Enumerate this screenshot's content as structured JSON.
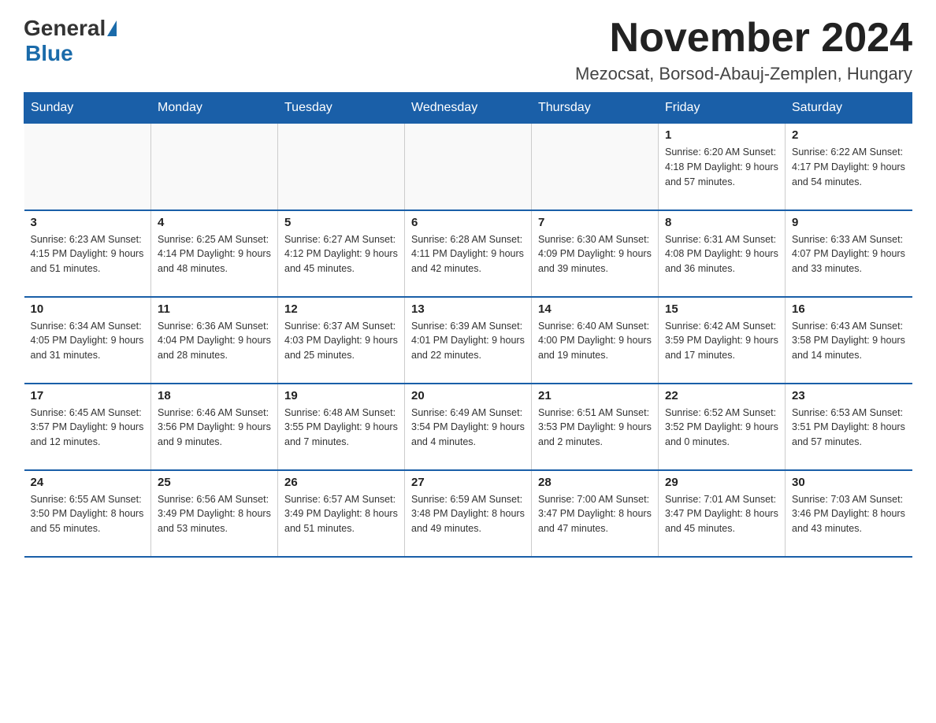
{
  "header": {
    "logo_general": "General",
    "logo_blue": "Blue",
    "month_year": "November 2024",
    "location": "Mezocsat, Borsod-Abauj-Zemplen, Hungary"
  },
  "weekdays": [
    "Sunday",
    "Monday",
    "Tuesday",
    "Wednesday",
    "Thursday",
    "Friday",
    "Saturday"
  ],
  "weeks": [
    [
      {
        "day": "",
        "info": ""
      },
      {
        "day": "",
        "info": ""
      },
      {
        "day": "",
        "info": ""
      },
      {
        "day": "",
        "info": ""
      },
      {
        "day": "",
        "info": ""
      },
      {
        "day": "1",
        "info": "Sunrise: 6:20 AM\nSunset: 4:18 PM\nDaylight: 9 hours and 57 minutes."
      },
      {
        "day": "2",
        "info": "Sunrise: 6:22 AM\nSunset: 4:17 PM\nDaylight: 9 hours and 54 minutes."
      }
    ],
    [
      {
        "day": "3",
        "info": "Sunrise: 6:23 AM\nSunset: 4:15 PM\nDaylight: 9 hours and 51 minutes."
      },
      {
        "day": "4",
        "info": "Sunrise: 6:25 AM\nSunset: 4:14 PM\nDaylight: 9 hours and 48 minutes."
      },
      {
        "day": "5",
        "info": "Sunrise: 6:27 AM\nSunset: 4:12 PM\nDaylight: 9 hours and 45 minutes."
      },
      {
        "day": "6",
        "info": "Sunrise: 6:28 AM\nSunset: 4:11 PM\nDaylight: 9 hours and 42 minutes."
      },
      {
        "day": "7",
        "info": "Sunrise: 6:30 AM\nSunset: 4:09 PM\nDaylight: 9 hours and 39 minutes."
      },
      {
        "day": "8",
        "info": "Sunrise: 6:31 AM\nSunset: 4:08 PM\nDaylight: 9 hours and 36 minutes."
      },
      {
        "day": "9",
        "info": "Sunrise: 6:33 AM\nSunset: 4:07 PM\nDaylight: 9 hours and 33 minutes."
      }
    ],
    [
      {
        "day": "10",
        "info": "Sunrise: 6:34 AM\nSunset: 4:05 PM\nDaylight: 9 hours and 31 minutes."
      },
      {
        "day": "11",
        "info": "Sunrise: 6:36 AM\nSunset: 4:04 PM\nDaylight: 9 hours and 28 minutes."
      },
      {
        "day": "12",
        "info": "Sunrise: 6:37 AM\nSunset: 4:03 PM\nDaylight: 9 hours and 25 minutes."
      },
      {
        "day": "13",
        "info": "Sunrise: 6:39 AM\nSunset: 4:01 PM\nDaylight: 9 hours and 22 minutes."
      },
      {
        "day": "14",
        "info": "Sunrise: 6:40 AM\nSunset: 4:00 PM\nDaylight: 9 hours and 19 minutes."
      },
      {
        "day": "15",
        "info": "Sunrise: 6:42 AM\nSunset: 3:59 PM\nDaylight: 9 hours and 17 minutes."
      },
      {
        "day": "16",
        "info": "Sunrise: 6:43 AM\nSunset: 3:58 PM\nDaylight: 9 hours and 14 minutes."
      }
    ],
    [
      {
        "day": "17",
        "info": "Sunrise: 6:45 AM\nSunset: 3:57 PM\nDaylight: 9 hours and 12 minutes."
      },
      {
        "day": "18",
        "info": "Sunrise: 6:46 AM\nSunset: 3:56 PM\nDaylight: 9 hours and 9 minutes."
      },
      {
        "day": "19",
        "info": "Sunrise: 6:48 AM\nSunset: 3:55 PM\nDaylight: 9 hours and 7 minutes."
      },
      {
        "day": "20",
        "info": "Sunrise: 6:49 AM\nSunset: 3:54 PM\nDaylight: 9 hours and 4 minutes."
      },
      {
        "day": "21",
        "info": "Sunrise: 6:51 AM\nSunset: 3:53 PM\nDaylight: 9 hours and 2 minutes."
      },
      {
        "day": "22",
        "info": "Sunrise: 6:52 AM\nSunset: 3:52 PM\nDaylight: 9 hours and 0 minutes."
      },
      {
        "day": "23",
        "info": "Sunrise: 6:53 AM\nSunset: 3:51 PM\nDaylight: 8 hours and 57 minutes."
      }
    ],
    [
      {
        "day": "24",
        "info": "Sunrise: 6:55 AM\nSunset: 3:50 PM\nDaylight: 8 hours and 55 minutes."
      },
      {
        "day": "25",
        "info": "Sunrise: 6:56 AM\nSunset: 3:49 PM\nDaylight: 8 hours and 53 minutes."
      },
      {
        "day": "26",
        "info": "Sunrise: 6:57 AM\nSunset: 3:49 PM\nDaylight: 8 hours and 51 minutes."
      },
      {
        "day": "27",
        "info": "Sunrise: 6:59 AM\nSunset: 3:48 PM\nDaylight: 8 hours and 49 minutes."
      },
      {
        "day": "28",
        "info": "Sunrise: 7:00 AM\nSunset: 3:47 PM\nDaylight: 8 hours and 47 minutes."
      },
      {
        "day": "29",
        "info": "Sunrise: 7:01 AM\nSunset: 3:47 PM\nDaylight: 8 hours and 45 minutes."
      },
      {
        "day": "30",
        "info": "Sunrise: 7:03 AM\nSunset: 3:46 PM\nDaylight: 8 hours and 43 minutes."
      }
    ]
  ]
}
